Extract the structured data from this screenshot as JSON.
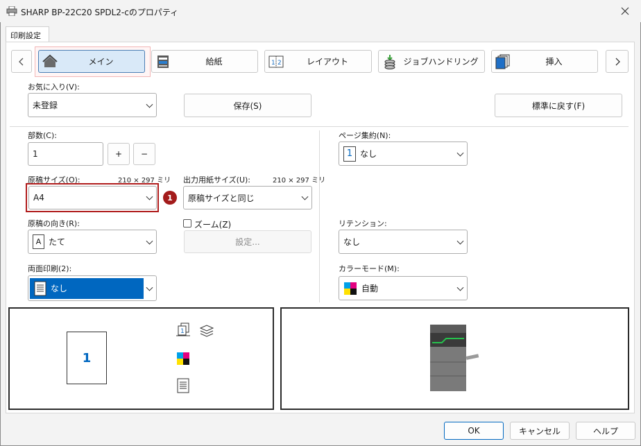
{
  "window": {
    "title": "SHARP BP-22C20 SPDL2-cのプロパティ"
  },
  "tab": {
    "label": "印刷設定"
  },
  "nav": {
    "items": [
      {
        "label": "メイン",
        "icon": "home-icon",
        "selected": true
      },
      {
        "label": "給紙",
        "icon": "paper-tray-icon"
      },
      {
        "label": "レイアウト",
        "icon": "layout-icon"
      },
      {
        "label": "ジョブハンドリング",
        "icon": "job-handling-icon"
      },
      {
        "label": "挿入",
        "icon": "insert-pages-icon"
      }
    ]
  },
  "favorites": {
    "label": "お気に入り(V):",
    "value": "未登録",
    "save": "保存(S)",
    "reset": "標準に戻す(F)"
  },
  "copies": {
    "label": "部数(C):",
    "value": "1",
    "plus": "+",
    "minus": "−"
  },
  "original_size": {
    "label": "原稿サイズ(O):",
    "dims": "210 × 297 ミリ",
    "value": "A4",
    "badge": "1"
  },
  "output_size": {
    "label": "出力用紙サイズ(U):",
    "dims": "210 × 297 ミリ",
    "value": "原稿サイズと同じ"
  },
  "orientation": {
    "label": "原稿の向き(R):",
    "value": "たて",
    "icon_letter": "A"
  },
  "zoom": {
    "label": "ズーム(Z)",
    "checked": false,
    "settings": "設定..."
  },
  "duplex": {
    "label": "両面印刷(2):",
    "value": "なし"
  },
  "nup": {
    "label": "ページ集約(N):",
    "value": "なし",
    "icon_number": "1"
  },
  "retention": {
    "label": "リテンション:",
    "value": "なし"
  },
  "color_mode": {
    "label": "カラーモード(M):",
    "value": "自動"
  },
  "preview": {
    "page_number": "1"
  },
  "footer": {
    "ok": "OK",
    "cancel": "キャンセル",
    "help": "ヘルプ"
  },
  "colors": {
    "accent": "#0067c0",
    "badge": "#a31b1b",
    "highlight_border": "#b01c1c",
    "selected_tab_bg": "#d9e9f8"
  }
}
